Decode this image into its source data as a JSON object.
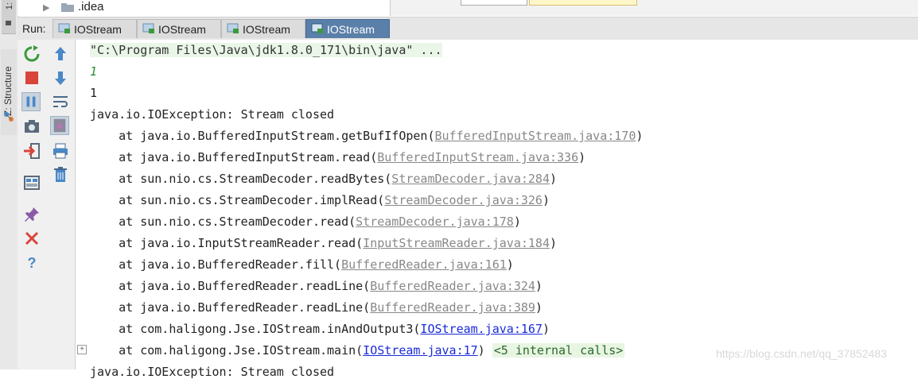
{
  "left_strip": {
    "top_tab_label": "1:",
    "structure_label": "Z: Structure"
  },
  "tree": {
    "folder_label": ".idea"
  },
  "run": {
    "label": "Run:",
    "tabs": [
      {
        "label": "IOStream",
        "active": false
      },
      {
        "label": "IOStream",
        "active": false
      },
      {
        "label": "IOStream",
        "active": false
      },
      {
        "label": "IOStream",
        "active": true
      }
    ]
  },
  "console": {
    "command": "\"C:\\Program Files\\Java\\jdk1.8.0_171\\bin\\java\" ...",
    "input_echo": "1",
    "output_1": "1",
    "exception": "java.io.IOException: Stream closed",
    "frames": [
      {
        "at": "    at java.io.BufferedInputStream.getBufIfOpen(",
        "link": "BufferedInputStream.java:170",
        "end": ")",
        "link_type": "grey"
      },
      {
        "at": "    at java.io.BufferedInputStream.read(",
        "link": "BufferedInputStream.java:336",
        "end": ")",
        "link_type": "grey"
      },
      {
        "at": "    at sun.nio.cs.StreamDecoder.readBytes(",
        "link": "StreamDecoder.java:284",
        "end": ")",
        "link_type": "grey"
      },
      {
        "at": "    at sun.nio.cs.StreamDecoder.implRead(",
        "link": "StreamDecoder.java:326",
        "end": ")",
        "link_type": "grey"
      },
      {
        "at": "    at sun.nio.cs.StreamDecoder.read(",
        "link": "StreamDecoder.java:178",
        "end": ")",
        "link_type": "grey"
      },
      {
        "at": "    at java.io.InputStreamReader.read(",
        "link": "InputStreamReader.java:184",
        "end": ")",
        "link_type": "grey"
      },
      {
        "at": "    at java.io.BufferedReader.fill(",
        "link": "BufferedReader.java:161",
        "end": ")",
        "link_type": "grey"
      },
      {
        "at": "    at java.io.BufferedReader.readLine(",
        "link": "BufferedReader.java:324",
        "end": ")",
        "link_type": "grey"
      },
      {
        "at": "    at java.io.BufferedReader.readLine(",
        "link": "BufferedReader.java:389",
        "end": ")",
        "link_type": "grey"
      },
      {
        "at": "    at com.haligong.Jse.IOStream.inAndOutput3(",
        "link": "IOStream.java:167",
        "end": ")",
        "link_type": "blue"
      },
      {
        "at": "    at com.haligong.Jse.IOStream.main(",
        "link": "IOStream.java:17",
        "end": ")",
        "link_type": "blue"
      }
    ],
    "internal_calls": "<5 internal calls>",
    "partial_line": "java.io.IOException: Stream closed"
  },
  "watermark": "https://blog.csdn.net/qq_37852483",
  "colors": {
    "active_tab": "#5a7fa8",
    "link_blue": "#1a2bd8",
    "link_grey": "#888888",
    "input_green": "#2e8b2e"
  }
}
